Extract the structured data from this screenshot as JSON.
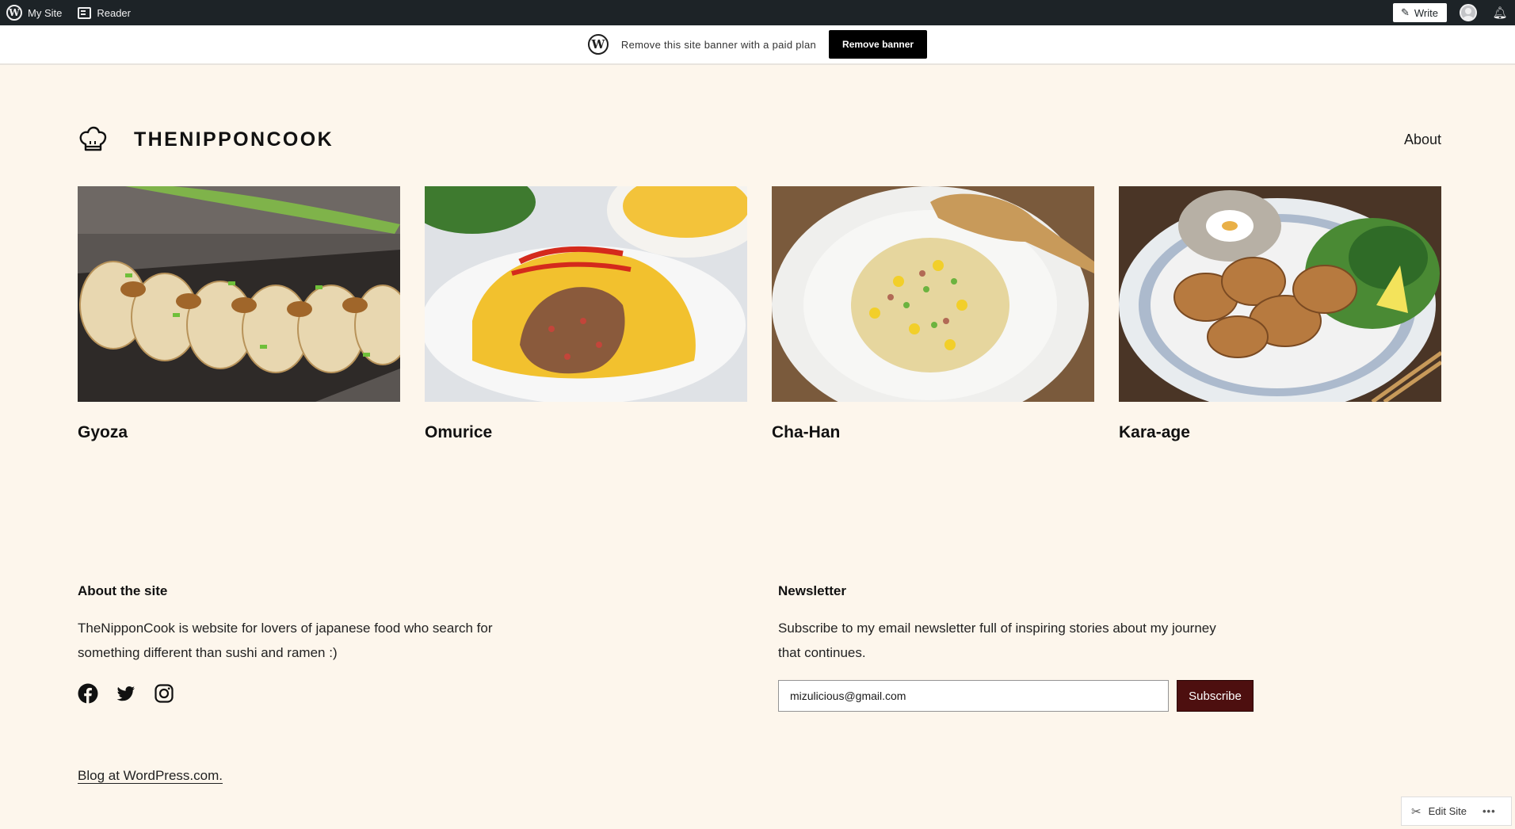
{
  "adminbar": {
    "my_site": "My Site",
    "reader": "Reader",
    "write": "Write"
  },
  "banner": {
    "text": "Remove this site banner with a paid plan",
    "button": "Remove banner"
  },
  "header": {
    "site_title": "THENIPPONCOOK",
    "nav": [
      "About"
    ]
  },
  "posts": [
    {
      "title": "Gyoza",
      "image": "gyoza-photo"
    },
    {
      "title": "Omurice",
      "image": "omurice-photo"
    },
    {
      "title": "Cha-Han",
      "image": "cha-han-photo"
    },
    {
      "title": "Kara-age",
      "image": "kara-age-photo"
    }
  ],
  "footer": {
    "about": {
      "title": "About the site",
      "line1": "TheNipponCook is website for lovers of japanese food who search for",
      "line2": "something different than sushi and ramen :)"
    },
    "newsletter": {
      "title": "Newsletter",
      "line1": "Subscribe to my email newsletter full of inspiring stories about my journey",
      "line2": "that continues.",
      "email_value": "mizulicious@gmail.com",
      "subscribe": "Subscribe"
    },
    "social": [
      "facebook-icon",
      "twitter-icon",
      "instagram-icon"
    ],
    "credit": "Blog at WordPress.com."
  },
  "edit_site": {
    "label": "Edit Site",
    "more": "•••"
  },
  "colors": {
    "page_bg": "#fdf6ec",
    "adminbar_bg": "#1d2327",
    "subscribe_bg": "#4d0f0f"
  }
}
